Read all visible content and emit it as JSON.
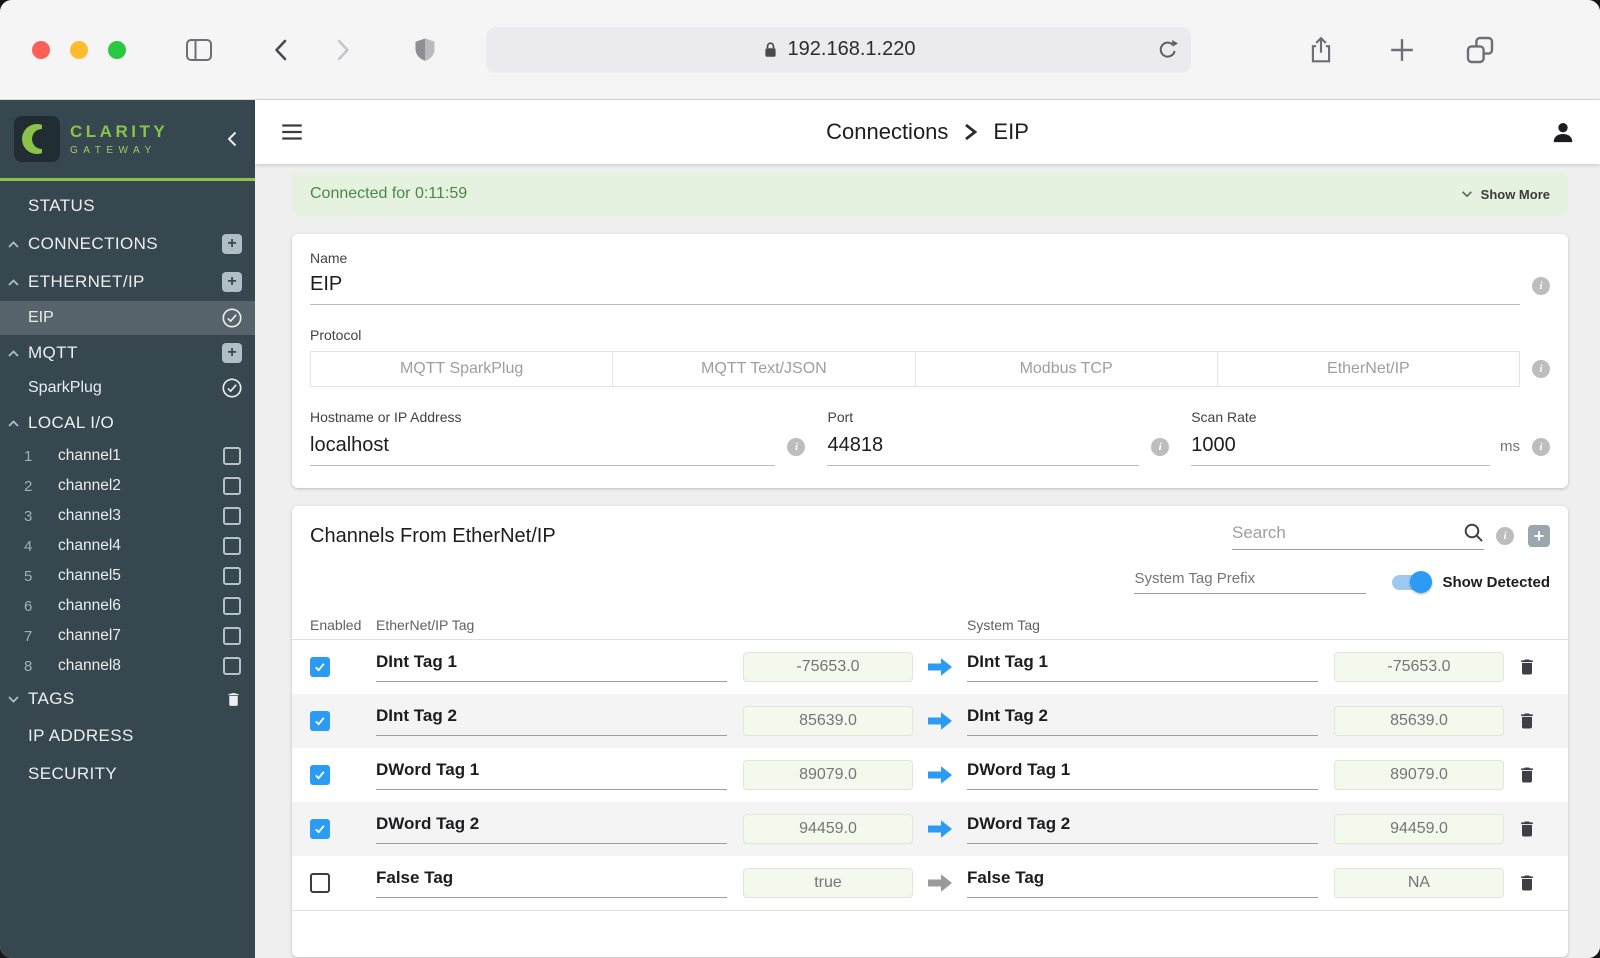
{
  "colors": {
    "brand_green": "#8BC34A",
    "accent_blue": "#2B9BF4",
    "sidebar_bg": "#37474F",
    "banner_bg": "#E4F2DF",
    "banner_text": "#4C8746",
    "value_box_bg": "#F3F9EC"
  },
  "browser": {
    "url": "192.168.1.220"
  },
  "sidebar": {
    "logo": {
      "line1": "CLARITY",
      "line2": "GATEWAY"
    },
    "status": "STATUS",
    "connections": "CONNECTIONS",
    "ethernet_ip": "ETHERNET/IP",
    "eip": "EIP",
    "mqtt": "MQTT",
    "sparkplug": "SparkPlug",
    "local_io": "LOCAL I/O",
    "tags": "TAGS",
    "ip_address": "IP ADDRESS",
    "security": "SECURITY",
    "channels": [
      {
        "num": "1",
        "label": "channel1"
      },
      {
        "num": "2",
        "label": "channel2"
      },
      {
        "num": "3",
        "label": "channel3"
      },
      {
        "num": "4",
        "label": "channel4"
      },
      {
        "num": "5",
        "label": "channel5"
      },
      {
        "num": "6",
        "label": "channel6"
      },
      {
        "num": "7",
        "label": "channel7"
      },
      {
        "num": "8",
        "label": "channel8"
      }
    ]
  },
  "header": {
    "breadcrumb": {
      "parent": "Connections",
      "current": "EIP"
    }
  },
  "banner": {
    "text": "Connected for 0:11:59",
    "show_more": "Show More"
  },
  "form": {
    "name_label": "Name",
    "name_value": "EIP",
    "protocol_label": "Protocol",
    "protocol_options": [
      "MQTT SparkPlug",
      "MQTT Text/JSON",
      "Modbus TCP",
      "EtherNet/IP"
    ],
    "hostname_label": "Hostname or IP Address",
    "hostname_value": "localhost",
    "port_label": "Port",
    "port_value": "44818",
    "scan_rate_label": "Scan Rate",
    "scan_rate_value": "1000",
    "scan_rate_unit": "ms"
  },
  "channels_table": {
    "title": "Channels From EtherNet/IP",
    "search_placeholder": "Search",
    "system_tag_prefix_placeholder": "System Tag Prefix",
    "show_detected_label": "Show Detected",
    "show_detected_on": true,
    "columns": {
      "enabled": "Enabled",
      "eip_tag": "EtherNet/IP Tag",
      "system_tag": "System Tag"
    },
    "rows": [
      {
        "enabled": true,
        "eip_tag": "DInt Tag 1",
        "eip_value": "-75653.0",
        "system_tag": "DInt Tag 1",
        "system_value": "-75653.0"
      },
      {
        "enabled": true,
        "eip_tag": "DInt Tag 2",
        "eip_value": "85639.0",
        "system_tag": "DInt Tag 2",
        "system_value": "85639.0"
      },
      {
        "enabled": true,
        "eip_tag": "DWord Tag 1",
        "eip_value": "89079.0",
        "system_tag": "DWord Tag 1",
        "system_value": "89079.0"
      },
      {
        "enabled": true,
        "eip_tag": "DWord Tag 2",
        "eip_value": "94459.0",
        "system_tag": "DWord Tag 2",
        "system_value": "94459.0"
      },
      {
        "enabled": false,
        "eip_tag": "False Tag",
        "eip_value": "true",
        "system_tag": "False Tag",
        "system_value": "NA"
      }
    ]
  }
}
